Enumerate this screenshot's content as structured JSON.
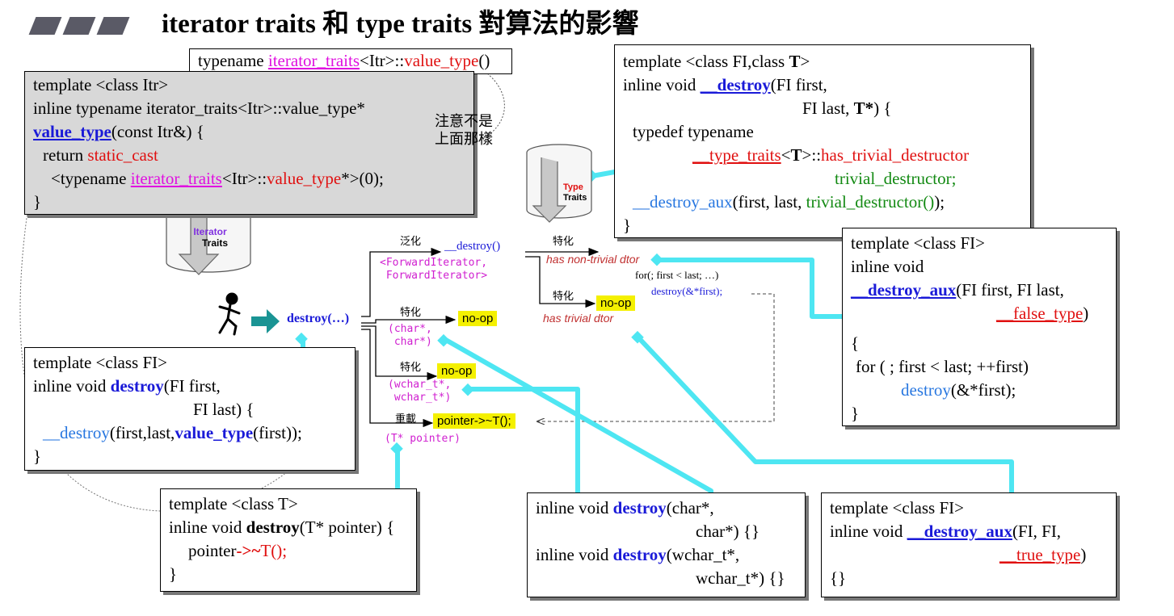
{
  "title": "iterator traits 和 type traits 對算法的影響",
  "callout_value_type": {
    "typename": "typename ",
    "traits": "iterator_traits",
    "itr": "<Itr>::",
    "vt": "value_type",
    "paren": "()"
  },
  "box_value_type": {
    "l1": "template <class Itr>",
    "l2": "inline typename iterator_traits<Itr>::value_type*",
    "l3_fn": "value_type",
    "l3_rest": "(const Itr&) {",
    "l4_return": "return ",
    "l4_cast": "static_cast",
    "l5_a": "<typename ",
    "l5_traits": "iterator_traits",
    "l5_b": "<Itr>::",
    "l5_vt": "value_type",
    "l5_c": "*>(0);",
    "l6": "}"
  },
  "note_not_above": {
    "l1": "注意不是",
    "l2": "上面那樣"
  },
  "cyl_iterator": {
    "l1": "Iterator",
    "l2": "Traits"
  },
  "cyl_type": {
    "l1": "Type",
    "l2": "Traits"
  },
  "box_destroy_generic": {
    "l1_a": "template <class FI,class ",
    "l1_t": "T",
    "l1_b": ">",
    "l2_a": "inline void ",
    "l2_fn": "__destroy",
    "l2_b": "(FI first,",
    "l3_a": "FI last, ",
    "l3_t": "T*",
    "l3_b": ") {",
    "l4": "typedef typename",
    "l5_traits": "__type_traits",
    "l5_a": "<",
    "l5_t": "T",
    "l5_b": ">::",
    "l5_has": "has_trivial_destructor",
    "l6": "trivial_destructor;",
    "l7_fn": "__destroy_aux",
    "l7_a": "(first, last, ",
    "l7_td": "trivial_destructor()",
    "l7_b": ");",
    "l8": "}"
  },
  "box_destroy_aux_false": {
    "l1": "template <class FI>",
    "l2": "inline void",
    "l3_fn": "__destroy_aux",
    "l3_rest": "(FI first, FI last,",
    "l4_ft": "__false_type",
    "l4_p": ")",
    "l5": "{",
    "l6": "for ( ; first < last; ++first)",
    "l7_fn": "destroy",
    "l7_rest": "(&*first);",
    "l8": "}"
  },
  "box_destroy_range": {
    "l1": "template <class FI>",
    "l2_a": "inline void ",
    "l2_fn": "destroy",
    "l2_b": "(FI first,",
    "l3": "FI last) {",
    "l4_fn": "__destroy",
    "l4_a": "(first,last,",
    "l4_vt": "value_type",
    "l4_b": "(first));",
    "l5": "}"
  },
  "box_destroy_pointer": {
    "l1": "template <class T>",
    "l2_a": "inline void ",
    "l2_fn": "destroy",
    "l2_b": "(T* pointer) {",
    "l3_a": "pointer",
    "l3_arrow": "->~",
    "l3_t": "T();",
    "l4": "}"
  },
  "box_destroy_char": {
    "l1_a": "inline void ",
    "l1_fn": "destroy",
    "l1_b": "(char*,",
    "l2": "char*) {}",
    "l3_a": "inline void ",
    "l3_fn": "destroy",
    "l3_b": "(wchar_t*,",
    "l4": "wchar_t*) {}"
  },
  "box_destroy_aux_true": {
    "l1": "template <class FI>",
    "l2_a": "inline void ",
    "l2_fn": "__destroy_aux",
    "l2_b": "(FI, FI,",
    "l3_tt": "__true_type",
    "l3_p": ")",
    "l4": "{}"
  },
  "flow": {
    "destroy_call": "destroy(…)",
    "generic_label": "泛化",
    "generic_fn": "__destroy()",
    "generic_args": "<ForwardIterator,\n ForwardIterator>",
    "spec1_label": "特化",
    "spec2_label": "特化",
    "spec3_label": "特化",
    "overload_label": "重載",
    "nonop_char": "no-op",
    "char_args": "(char*,\n char*)",
    "nonop_wchar": "no-op",
    "wchar_args": "(wchar_t*,\n wchar_t*)",
    "pointer_call": "pointer->~T();",
    "pointer_args": "(T* pointer)",
    "spec_top_label": "特化",
    "spec_mid_label": "特化",
    "nontrivial": "has non-trivial dtor",
    "trivial": "has trivial dtor",
    "nonop_trivial": "no-op",
    "loop_l1": "for(; first < last; …)",
    "loop_l2": "destroy(&*first);"
  },
  "colors": {
    "blue": "#1a1ad8",
    "light_blue": "#2877e0",
    "red": "#e01010",
    "magenta": "#e010e0",
    "green": "#138a13",
    "cyan_link": "#4ee6f2",
    "highlight": "#f4f000"
  }
}
